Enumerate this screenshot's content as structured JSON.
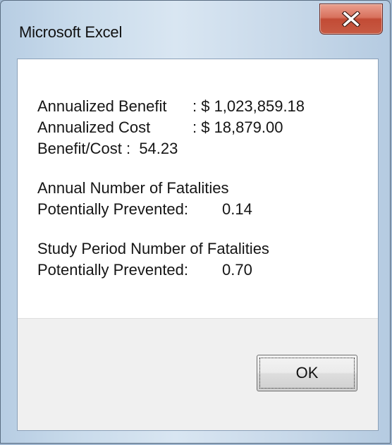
{
  "window": {
    "title": "Microsoft Excel"
  },
  "titlebar": {
    "close_icon": "close-x-icon",
    "close_color": "#c75a43"
  },
  "message": {
    "annualized_benefit_label": "Annualized Benefit",
    "annualized_benefit_value": ": $ 1,023,859.18",
    "annualized_cost_label": "Annualized Cost",
    "annualized_cost_value": ": $ 18,879.00",
    "benefit_cost_label": "Benefit/Cost :",
    "benefit_cost_value": "54.23",
    "annual_fatalities_heading": "Annual Number of Fatalities",
    "annual_prevented_label": "Potentially Prevented:",
    "annual_prevented_value": "0.14",
    "study_fatalities_heading": "Study Period Number of Fatalities",
    "study_prevented_label": "Potentially Prevented:",
    "study_prevented_value": "0.70"
  },
  "buttons": {
    "ok_label": "OK"
  }
}
